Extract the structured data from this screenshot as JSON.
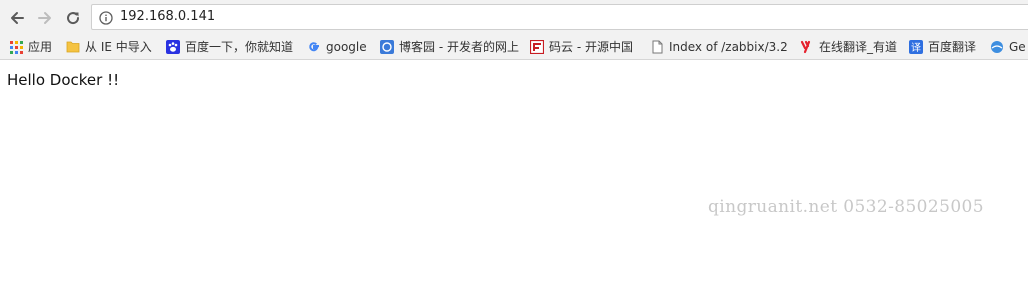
{
  "browser": {
    "address_bar": {
      "url": "192.168.0.141",
      "info_icon": "info-icon"
    },
    "nav": {
      "back_icon": "back-arrow-icon",
      "forward_icon": "forward-arrow-icon",
      "reload_icon": "reload-icon"
    },
    "bookmarks": [
      {
        "label": "应用",
        "icon": "apps-grid-icon"
      },
      {
        "label": "从 IE 中导入",
        "icon": "folder-icon"
      },
      {
        "label": "百度一下，你就知道",
        "icon": "baidu-paw-icon"
      },
      {
        "label": "google",
        "icon": "google-g-icon"
      },
      {
        "label": "博客园 - 开发者的网上",
        "icon": "cnblogs-icon"
      },
      {
        "label": "码云 - 开源中国",
        "icon": "gitee-icon"
      },
      {
        "label": "Index of /zabbix/3.2",
        "icon": "page-icon"
      },
      {
        "label": "在线翻译_有道",
        "icon": "youdao-icon"
      },
      {
        "label": "百度翻译",
        "icon": "baidu-translate-icon"
      },
      {
        "label": "Ge",
        "icon": "globe-icon"
      }
    ]
  },
  "page": {
    "body_text": "Hello Docker !!"
  },
  "watermark": {
    "text": "qingruanit.net 0532-85025005"
  },
  "colors": {
    "chrome_bg": "#f2f2f2",
    "baidu_blue": "#2932e1",
    "gitee_red": "#c71d23",
    "youdao_red": "#e5212d",
    "folder_yellow": "#f5c342"
  }
}
